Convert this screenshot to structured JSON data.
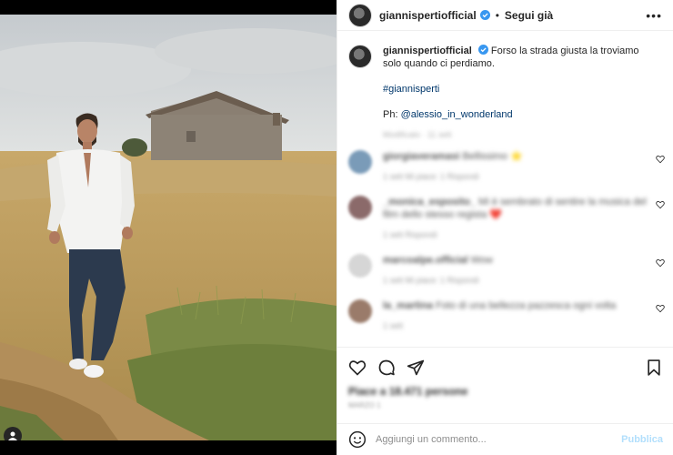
{
  "header": {
    "username": "giannispertiofficial",
    "separator": "•",
    "follow_label": "Segui già",
    "more_label": "•••"
  },
  "caption": {
    "username": "giannispertiofficial",
    "text": "Forso la strada giusta la troviamo solo quando ci perdiamo.",
    "hashtag": "#giannisperti",
    "credit_prefix": "Ph: ",
    "credit_handle": "@alessio_in_wonderland",
    "time": "Modificato · 11 sett"
  },
  "comments": [
    {
      "username": "giorgiaveramasi",
      "text": "Bellissimo ⭐",
      "meta": "1 sett   Mi piace: 1   Rispondi",
      "avatar_color": "#7a9bb8"
    },
    {
      "username": "_monica_esposito_",
      "text": "Mi è sembrato di sentire la musica del film dello stesso regista ❤️",
      "meta": "1 sett   Rispondi",
      "avatar_color": "#8b6a6a"
    },
    {
      "username": "marcoalpe.official",
      "text": "Wow",
      "meta": "1 sett   Mi piace: 1   Rispondi",
      "avatar_color": "#d6d6d6"
    },
    {
      "username": "la_martina",
      "text": "Foto di una bellezza pazzesca ogni volta",
      "meta": "1 sett",
      "avatar_color": "#9a7b6a"
    }
  ],
  "likes_text": "Piace a 18.471 persone",
  "date_text": "MARZO 1",
  "add_comment": {
    "placeholder": "Aggiungi un commento...",
    "publish_label": "Pubblica"
  },
  "colors": {
    "verified": "#3897f0",
    "link": "#00376b",
    "publish_disabled": "#b2dffc"
  }
}
